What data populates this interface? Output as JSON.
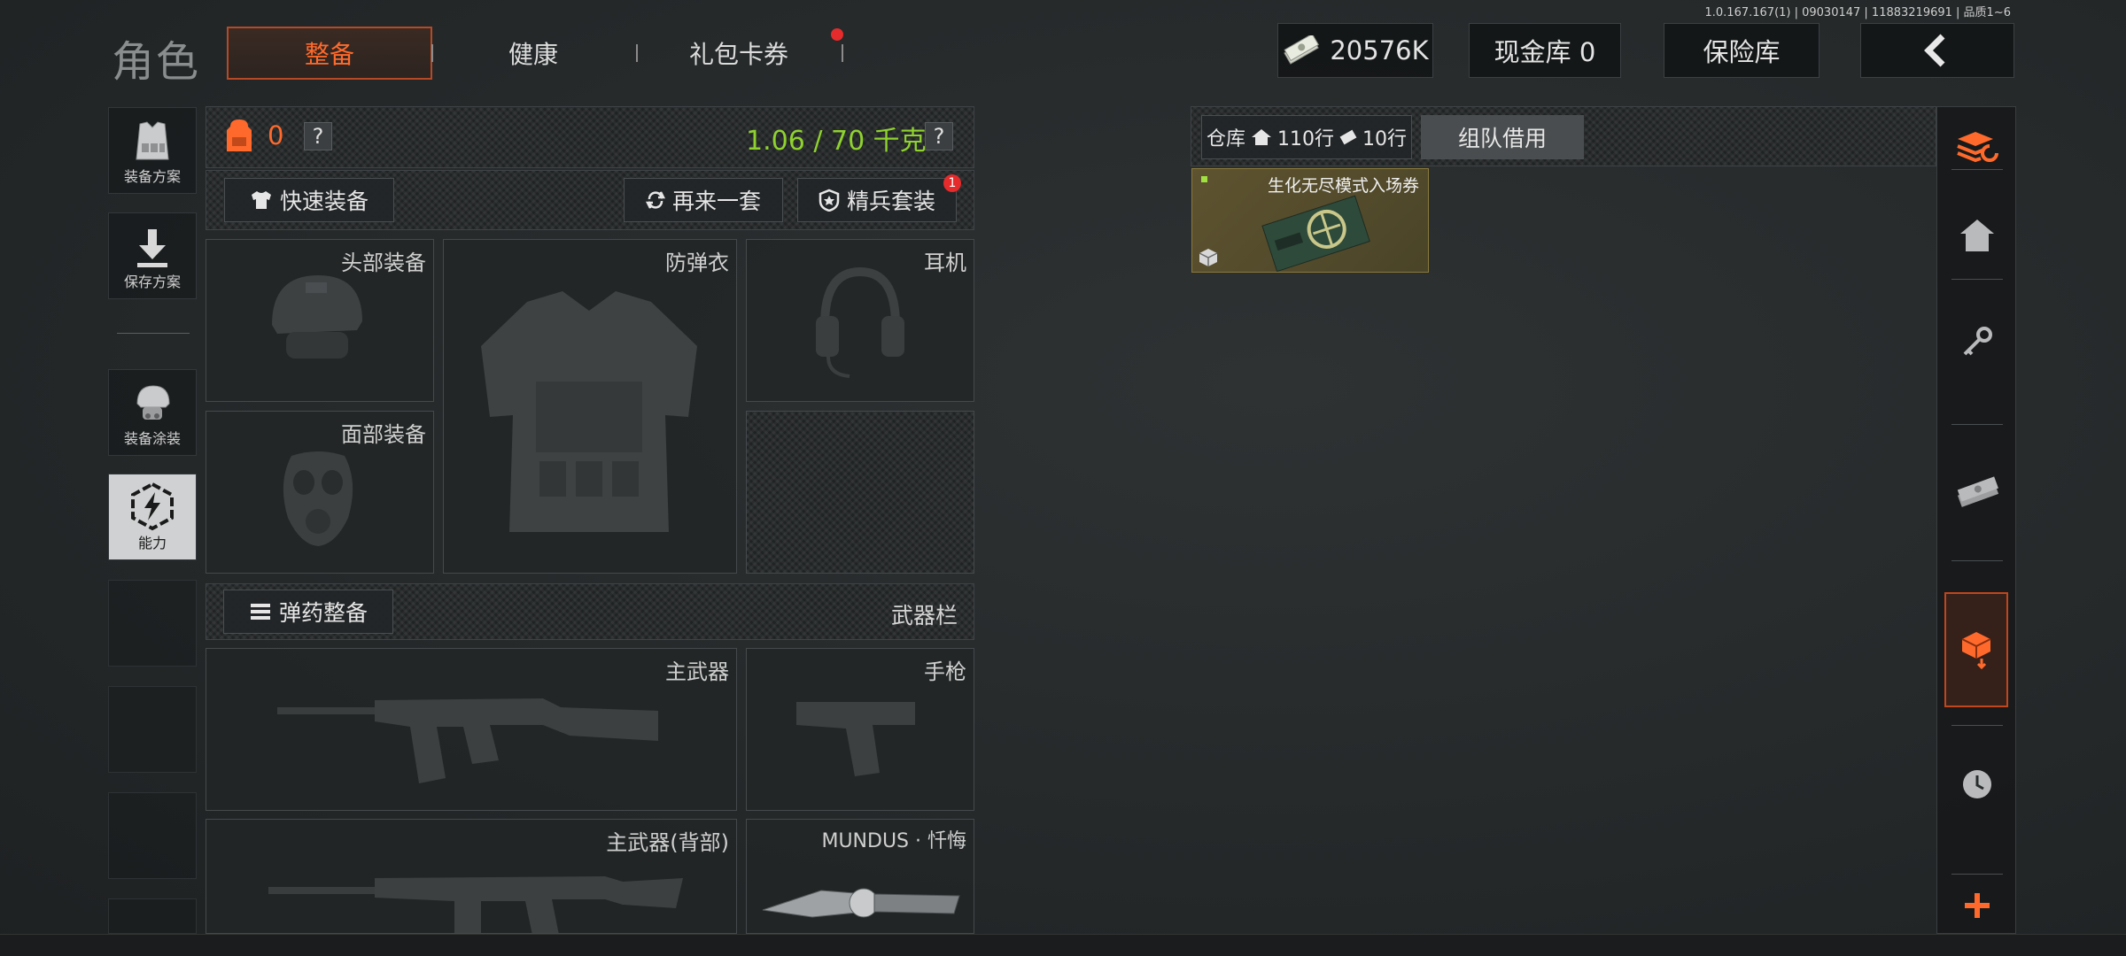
{
  "version_text": "1.0.167.167(1) | 09030147 | 11883219691 | 品质1~6",
  "header": {
    "title": "角色",
    "tabs": [
      {
        "label": "整备",
        "active": true
      },
      {
        "label": "健康",
        "active": false
      },
      {
        "label": "礼包卡券",
        "active": false,
        "has_notification": true
      }
    ],
    "currency_value": "20576K",
    "cash_vault_label": "现金库 0",
    "safe_label": "保险库",
    "back_icon": "chevron-left-icon"
  },
  "left_rail": [
    {
      "label": "装备方案",
      "icon": "vest-icon"
    },
    {
      "label": "保存方案",
      "icon": "download-icon"
    },
    {
      "label": "装备涂装",
      "icon": "helmet-icon"
    },
    {
      "label": "能力",
      "icon": "ability-icon",
      "active": true
    }
  ],
  "loadout": {
    "bag_count": "0",
    "weight_text": "1.06 / 70 千克",
    "quick_equip_label": "快速装备",
    "again_label": "再来一套",
    "elite_label": "精兵套装",
    "elite_badge": "1",
    "slots": {
      "head": "头部装备",
      "armor": "防弹衣",
      "headset": "耳机",
      "face": "面部装备"
    },
    "ammo_label": "弹药整备",
    "weapon_bar_label": "武器栏",
    "weapons": {
      "primary": "主武器",
      "pistol": "手枪",
      "primary_back": "主武器(背部)",
      "melee": "MUNDUS · 忏悔"
    },
    "question": "?"
  },
  "storage": {
    "warehouse_label": "仓库",
    "rows_label": "110行",
    "cash_rows_label": "10行",
    "team_borrow_label": "组队借用",
    "item_name": "生化无尽模式入场券"
  },
  "right_rail_icons": [
    "stack-refresh-icon",
    "home-icon",
    "key-icon",
    "cash-icon",
    "deposit-icon",
    "clock-icon",
    "plus-icon"
  ],
  "colors": {
    "accent": "#ff6a2c",
    "weight_green": "#8fd22e",
    "notification_red": "#e52b2b"
  }
}
